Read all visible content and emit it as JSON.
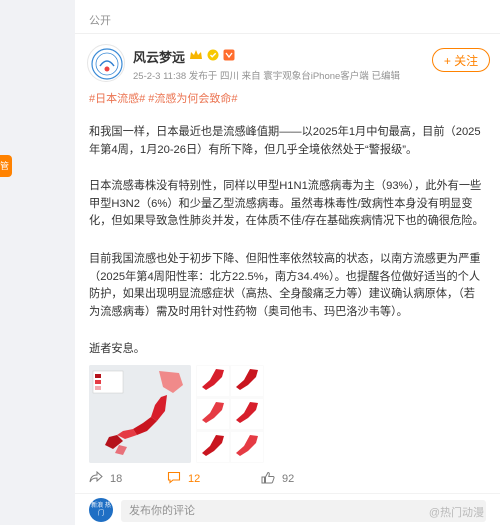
{
  "sidebar": {
    "tab_label": "管理"
  },
  "post": {
    "visibility": "公开",
    "author": "风云梦远",
    "meta": "25-2-3 11:38 发布于 四川  来自 寰宇观象台iPhone客户端  已编辑",
    "follow_label": "+ 关注",
    "tags": "#日本流感# #流感为何会致命#",
    "paragraphs": [
      "和我国一样，日本最近也是流感峰值期——以2025年1月中旬最高，目前（2025年第4周，1月20-26日）有所下降，但几乎全境依然处于“警报级”。",
      "日本流感毒株没有特别性，同样以甲型H1N1流感病毒为主（93%），此外有一些甲型H3N2（6%）和少量乙型流感病毒。虽然毒株毒性/致病性本身没有明显变化，但如果导致急性肺炎并发，在体质不佳/存在基础疾病情况下也的确很危险。",
      "目前我国流感也处于初步下降、但阳性率依然较高的状态，以南方流感更为严重（2025年第4周阳性率：北方22.5%，南方34.4%）。也提醒各位做好适当的个人防护，如果出现明显流感症状（高热、全身酸痛乏力等）建议确认病原体，（若为流感病毒）需及时用针对性药物（奥司他韦、玛巴洛沙韦等）。",
      "逝者安息。"
    ]
  },
  "actions": {
    "share_count": "18",
    "comment_count": "12",
    "like_count": "92"
  },
  "comment": {
    "placeholder": "发布你的评论",
    "avatar_text": "新浪 热门"
  },
  "watermark": "@热门动漫",
  "colors": {
    "brand_orange": "#ff8200",
    "tag_color": "#eb7350",
    "map_red": "#d71e2b"
  },
  "icons": [
    "vip-crown-icon",
    "share-icon",
    "comment-icon",
    "like-icon",
    "plus-icon"
  ]
}
